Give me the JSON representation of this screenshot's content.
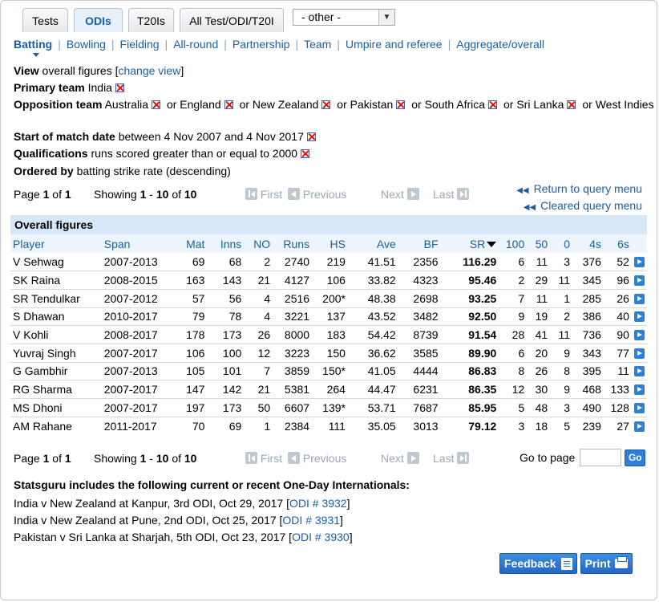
{
  "tabs": [
    {
      "label": "Tests",
      "active": false
    },
    {
      "label": "ODIs",
      "active": true
    },
    {
      "label": "T20Is",
      "active": false
    },
    {
      "label": "All Test/ODI/T20I",
      "active": false
    }
  ],
  "other_select": {
    "value": "- other -"
  },
  "subnav": [
    "Batting",
    "Bowling",
    "Fielding",
    "All-round",
    "Partnership",
    "Team",
    "Umpire and referee",
    "Aggregate/overall"
  ],
  "filters": {
    "view_label": "View",
    "view_value": "overall figures [",
    "change_view": "change view",
    "view_close": "]",
    "primary_label": "Primary team",
    "primary_value": "India",
    "opposition_label": "Opposition team",
    "opposition_teams": [
      "Australia",
      "England",
      "New Zealand",
      "Pakistan",
      "South Africa",
      "Sri Lanka",
      "West Indies"
    ],
    "or_word": "or",
    "start_label": "Start of match date",
    "start_value": "between 4 Nov 2007 and 4 Nov 2017",
    "qual_label": "Qualifications",
    "qual_value": "runs scored greater than or equal to 2000",
    "ordered_label": "Ordered by",
    "ordered_value": "batting strike rate (descending)"
  },
  "pager": {
    "page_word": "Page",
    "page": "1",
    "of_word": "of",
    "pages": "1",
    "showing_word": "Showing",
    "from": "1",
    "dash": "-",
    "to": "10",
    "total": "10",
    "first": "First",
    "previous": "Previous",
    "next": "Next",
    "last": "Last",
    "goto_label": "Go to page",
    "go_button": "Go"
  },
  "query_links": {
    "return": "Return to query menu",
    "cleared": "Cleared query menu"
  },
  "table": {
    "caption": "Overall figures",
    "headers": [
      "Player",
      "Span",
      "Mat",
      "Inns",
      "NO",
      "Runs",
      "HS",
      "Ave",
      "BF",
      "SR",
      "100",
      "50",
      "0",
      "4s",
      "6s"
    ],
    "rows": [
      [
        "V Sehwag",
        "2007-2013",
        "69",
        "68",
        "2",
        "2740",
        "219",
        "41.51",
        "2356",
        "116.29",
        "6",
        "11",
        "3",
        "376",
        "52"
      ],
      [
        "SK Raina",
        "2008-2015",
        "163",
        "143",
        "21",
        "4127",
        "106",
        "33.82",
        "4323",
        "95.46",
        "2",
        "29",
        "11",
        "345",
        "96"
      ],
      [
        "SR Tendulkar",
        "2007-2012",
        "57",
        "56",
        "4",
        "2516",
        "200*",
        "48.38",
        "2698",
        "93.25",
        "7",
        "11",
        "1",
        "285",
        "26"
      ],
      [
        "S Dhawan",
        "2010-2017",
        "79",
        "78",
        "4",
        "3221",
        "137",
        "43.52",
        "3482",
        "92.50",
        "9",
        "19",
        "2",
        "386",
        "40"
      ],
      [
        "V Kohli",
        "2008-2017",
        "178",
        "173",
        "26",
        "8000",
        "183",
        "54.42",
        "8739",
        "91.54",
        "28",
        "41",
        "11",
        "736",
        "90"
      ],
      [
        "Yuvraj Singh",
        "2007-2017",
        "106",
        "100",
        "12",
        "3223",
        "150",
        "36.62",
        "3585",
        "89.90",
        "6",
        "20",
        "9",
        "343",
        "77"
      ],
      [
        "G Gambhir",
        "2007-2013",
        "105",
        "101",
        "7",
        "3859",
        "150*",
        "41.05",
        "4444",
        "86.83",
        "8",
        "26",
        "8",
        "395",
        "11"
      ],
      [
        "RG Sharma",
        "2007-2017",
        "147",
        "142",
        "21",
        "5381",
        "264",
        "44.47",
        "6231",
        "86.35",
        "12",
        "30",
        "9",
        "468",
        "133"
      ],
      [
        "MS Dhoni",
        "2007-2017",
        "197",
        "173",
        "50",
        "6607",
        "139*",
        "53.71",
        "7687",
        "85.95",
        "5",
        "48",
        "3",
        "490",
        "128"
      ],
      [
        "AM Rahane",
        "2011-2017",
        "70",
        "69",
        "1",
        "2384",
        "111",
        "35.05",
        "3013",
        "79.12",
        "3",
        "18",
        "5",
        "239",
        "27"
      ]
    ]
  },
  "footer": {
    "heading": "Statsguru includes the following current or recent One-Day Internationals:",
    "matches": [
      {
        "text": "India v New Zealand at Kanpur, 3rd ODI, Oct 29, 2017 [",
        "link": "ODI # 3932",
        "close": "]"
      },
      {
        "text": "India v New Zealand at Pune, 2nd ODI, Oct 25, 2017 [",
        "link": "ODI # 3931",
        "close": "]"
      },
      {
        "text": "Pakistan v Sri Lanka at Sharjah, 5th ODI, Oct 23, 2017 [",
        "link": "ODI # 3930",
        "close": "]"
      }
    ]
  },
  "actions": {
    "feedback": "Feedback",
    "print": "Print"
  },
  "colors": {
    "link": "#1a5fa8",
    "caption_bg": "#d6e7f7",
    "button": "#2e7fd6"
  }
}
